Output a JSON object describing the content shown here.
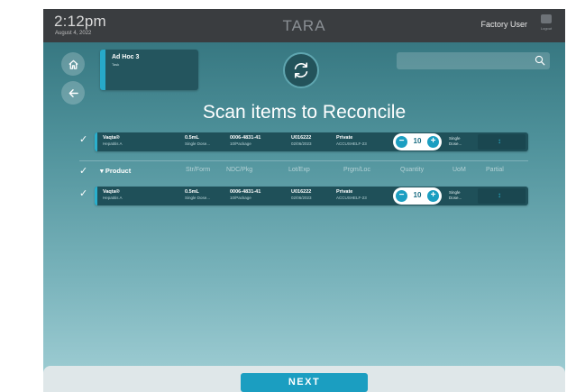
{
  "header": {
    "time": "2:12pm",
    "date": "August 4, 2022",
    "app_name": "TARA",
    "user": "Factory User",
    "logout_label": "Logout"
  },
  "task": {
    "name": "Ad Hoc 3",
    "subtitle": "Task"
  },
  "search": {
    "placeholder": ""
  },
  "page_title": "Scan items to Reconcile",
  "columns": [
    "Product",
    "Str/Form",
    "NDC/Pkg",
    "Lot/Exp",
    "Prgm/Loc",
    "Quantity",
    "UoM",
    "Partial"
  ],
  "scanned_item": {
    "product": "Vaqta®",
    "product_sub": "Hepatitis A",
    "strength": "0.5mL",
    "form": "Single Dose...",
    "ndc": "0006-4831-41",
    "pkg": "10/Package",
    "lot": "U016222",
    "exp": "02/06/2023",
    "program": "Private",
    "location": "ACCUSHELF-23",
    "quantity": "10",
    "uom_1": "Single",
    "uom_2": "Dose..."
  },
  "items": [
    {
      "product": "Vaqta®",
      "product_sub": "Hepatitis A",
      "strength": "0.5mL",
      "form": "Single Dose...",
      "ndc": "0006-4831-41",
      "pkg": "10/Package",
      "lot": "U016222",
      "exp": "02/06/2023",
      "program": "Private",
      "location": "ACCUSHELF-23",
      "quantity": "10",
      "uom_1": "Single",
      "uom_2": "Dose..."
    }
  ],
  "footer": {
    "next_label": "NEXT"
  },
  "colors": {
    "accent": "#1b9ec1",
    "row_bg": "#1f5059",
    "topbar": "#3a3d40"
  }
}
